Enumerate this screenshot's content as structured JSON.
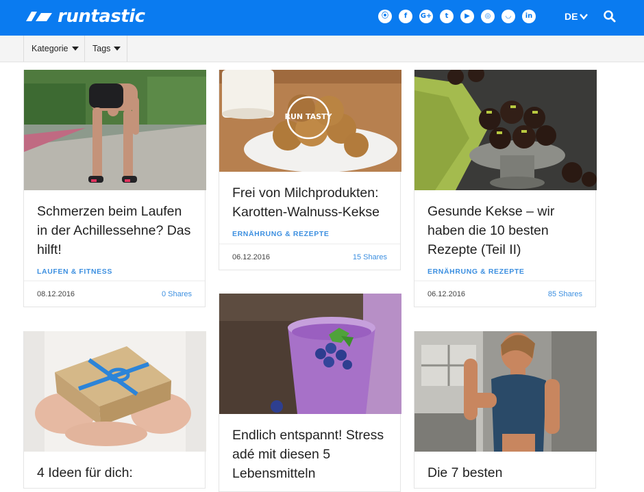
{
  "header": {
    "logo_text": "runtastic",
    "social_icons": [
      "rss-icon",
      "facebook-icon",
      "google-plus-icon",
      "twitter-icon",
      "youtube-icon",
      "instagram-icon",
      "snapchat-icon",
      "linkedin-icon"
    ],
    "social_glyphs": [
      "⦿",
      "f",
      "G+",
      "t",
      "▶",
      "◎",
      "◡",
      "in"
    ],
    "language": "DE"
  },
  "filters": {
    "kategorie": "Kategorie",
    "tags": "Tags"
  },
  "colors": {
    "brand": "#0a7bf0",
    "link": "#3c8fe0"
  },
  "cards": [
    {
      "title": "Schmerzen beim Laufen in der Achillessehne? Das hilft!",
      "category": "LAUFEN & FITNESS",
      "date": "08.12.2016",
      "shares": "0 Shares"
    },
    {
      "title": "Frei von Milchprodukten: Karotten-Walnuss-Kekse",
      "category": "ERNÄHRUNG & REZEPTE",
      "date": "06.12.2016",
      "shares": "15 Shares",
      "image_text": "RUN TASTY"
    },
    {
      "title": "Gesunde Kekse – wir haben die 10 besten Rezepte (Teil II)",
      "category": "ERNÄHRUNG & REZEPTE",
      "date": "06.12.2016",
      "shares": "85 Shares"
    },
    {
      "title": "4 Ideen für dich:"
    },
    {
      "title": "Endlich entspannt! Stress adé mit diesen 5 Lebensmitteln"
    },
    {
      "title": "Die 7 besten"
    }
  ]
}
